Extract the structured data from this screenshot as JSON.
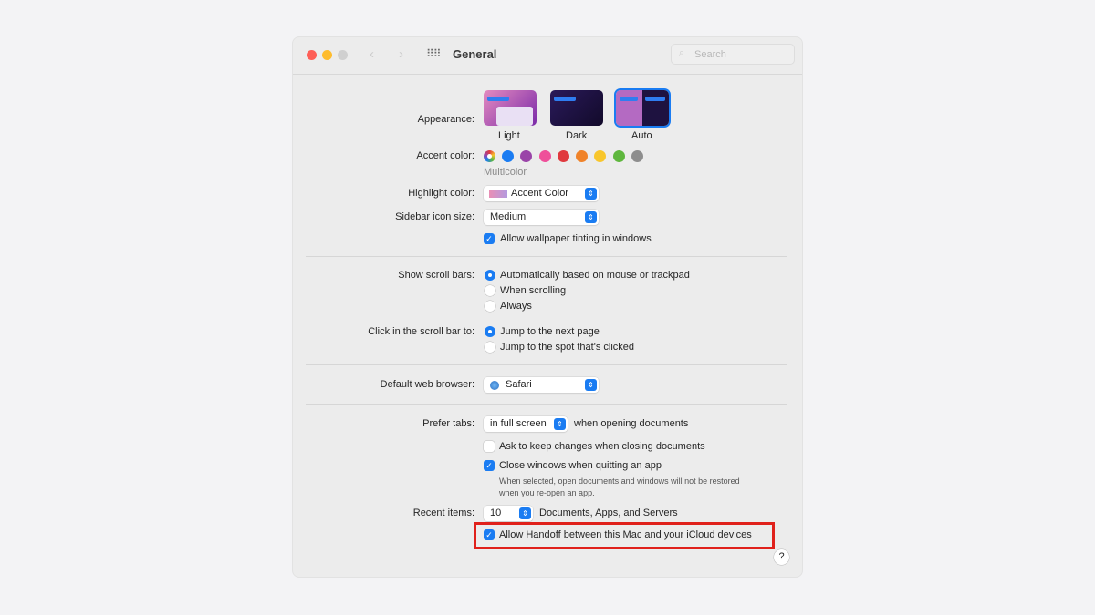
{
  "window": {
    "title": "General",
    "search_placeholder": "Search"
  },
  "appearance": {
    "label": "Appearance:",
    "options": [
      "Light",
      "Dark",
      "Auto"
    ],
    "selected": "Auto"
  },
  "accent": {
    "label": "Accent color:",
    "selected_name": "Multicolor",
    "colors": [
      "multicolor",
      "#1a7cf2",
      "#9a44a8",
      "#ef4f9a",
      "#e0393e",
      "#f0832a",
      "#f8c62c",
      "#5fb73e",
      "#8e8e8e"
    ]
  },
  "highlight": {
    "label": "Highlight color:",
    "value": "Accent Color"
  },
  "sidebar_icon": {
    "label": "Sidebar icon size:",
    "value": "Medium"
  },
  "wallpaper_tinting": {
    "label": "Allow wallpaper tinting in windows",
    "checked": true
  },
  "scroll_bars": {
    "label": "Show scroll bars:",
    "options": [
      "Automatically based on mouse or trackpad",
      "When scrolling",
      "Always"
    ],
    "selected": 0
  },
  "click_scroll": {
    "label": "Click in the scroll bar to:",
    "options": [
      "Jump to the next page",
      "Jump to the spot that's clicked"
    ],
    "selected": 0
  },
  "browser": {
    "label": "Default web browser:",
    "value": "Safari"
  },
  "prefer_tabs": {
    "label": "Prefer tabs:",
    "value": "in full screen",
    "suffix": "when opening documents"
  },
  "ask_keep": {
    "label": "Ask to keep changes when closing documents",
    "checked": false
  },
  "close_windows": {
    "label": "Close windows when quitting an app",
    "checked": true,
    "note1": "When selected, open documents and windows will not be restored",
    "note2": "when you re-open an app."
  },
  "recent": {
    "label": "Recent items:",
    "value": "10",
    "suffix": "Documents, Apps, and Servers"
  },
  "handoff": {
    "label": "Allow Handoff between this Mac and your iCloud devices",
    "checked": true
  },
  "help": "?",
  "highlight_box_color": "#e0211b"
}
